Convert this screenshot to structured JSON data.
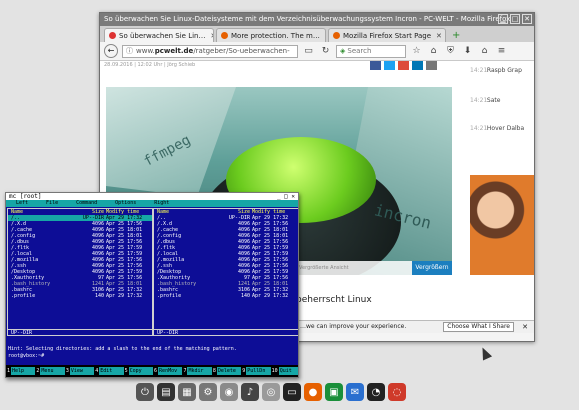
{
  "firefox": {
    "title": "So überwachen Sie Linux-Dateisysteme mit dem Verzeichnisüberwachungssystem Incron - PC-WELT - Mozilla Firefox",
    "window_controls": [
      "▁",
      "□",
      "✕"
    ],
    "tabs": [
      {
        "label": "So überwachen Sie Lin…",
        "active": true
      },
      {
        "label": "More protection. The m…",
        "active": false
      },
      {
        "label": "Mozilla Firefox Start Page",
        "active": false
      }
    ],
    "new_tab": "+",
    "url": {
      "prefix": "www.",
      "domain": "pcwelt.de",
      "path": "/ratgeber/So-ueberwachen-"
    },
    "search_placeholder": "Search",
    "toolbar_icons": [
      "☆",
      "⌂",
      "⛨",
      "⬇",
      "⌂",
      "≡"
    ]
  },
  "article": {
    "date_line": "28.09.2016 | 12:02 Uhr | Jörg Schieb",
    "image_engraving_1": "ffmpeg",
    "image_engraving_2": "incron",
    "image_caption": "Vergrößerte Ansicht",
    "enlarge_label": "Vergrößern",
    "headline": "beherrscht Linux"
  },
  "sidebar": {
    "news": [
      {
        "time": "14:21",
        "headline": "Raspb Grap"
      },
      {
        "time": "14:21",
        "headline": "Sate"
      },
      {
        "time": "14:21",
        "headline": "Hover Dalba"
      }
    ]
  },
  "notification": {
    "text": "…we can improve your experience.",
    "button": "Choose What I Share",
    "close": "✕"
  },
  "mc": {
    "title": "mc [root]",
    "title_controls": "_ □ ✕",
    "menu": [
      "Left",
      "File",
      "Command",
      "Options",
      "Right"
    ],
    "left_pane": {
      "headers": {
        "name": "Name",
        "size": "Size",
        "time": "Modify time"
      },
      "rows": [
        {
          "name": "/..",
          "size": "UP--DIR",
          "time": "Apr 29 17:32",
          "sel": true
        },
        {
          "name": "/.X.d",
          "size": "4096",
          "time": "Apr 25 17:56"
        },
        {
          "name": "/.cache",
          "size": "4096",
          "time": "Apr 25 18:01"
        },
        {
          "name": "/.config",
          "size": "4096",
          "time": "Apr 25 18:01"
        },
        {
          "name": "/.dbus",
          "size": "4096",
          "time": "Apr 25 17:56"
        },
        {
          "name": "/.fltk",
          "size": "4096",
          "time": "Apr 25 17:59"
        },
        {
          "name": "/.local",
          "size": "4096",
          "time": "Apr 25 17:59"
        },
        {
          "name": "/.mozilla",
          "size": "4096",
          "time": "Apr 25 17:56"
        },
        {
          "name": "/.ssh",
          "size": "4096",
          "time": "Apr 25 17:56"
        },
        {
          "name": "/Desktop",
          "size": "4096",
          "time": "Apr 25 17:59"
        },
        {
          "name": " .Xauthority",
          "size": "97",
          "time": "Apr 25 17:56"
        },
        {
          "name": " .bash_history",
          "size": "1241",
          "time": "Apr 25 18:01",
          "dim": true
        },
        {
          "name": " .bashrc",
          "size": "3106",
          "time": "Apr 25 17:32"
        },
        {
          "name": " .profile",
          "size": "140",
          "time": "Apr 29 17:32"
        }
      ],
      "footer": "UP--DIR"
    },
    "right_pane": {
      "headers": {
        "name": "Name",
        "size": "Size",
        "time": "Modify time"
      },
      "rows": [
        {
          "name": "/..",
          "size": "UP--DIR",
          "time": "Apr 29 17:32"
        },
        {
          "name": "/.X.d",
          "size": "4096",
          "time": "Apr 25 17:56"
        },
        {
          "name": "/.cache",
          "size": "4096",
          "time": "Apr 25 18:01"
        },
        {
          "name": "/.config",
          "size": "4096",
          "time": "Apr 25 18:01"
        },
        {
          "name": "/.dbus",
          "size": "4096",
          "time": "Apr 25 17:56"
        },
        {
          "name": "/.fltk",
          "size": "4096",
          "time": "Apr 25 17:59"
        },
        {
          "name": "/.local",
          "size": "4096",
          "time": "Apr 25 17:59"
        },
        {
          "name": "/.mozilla",
          "size": "4096",
          "time": "Apr 25 17:56"
        },
        {
          "name": "/.ssh",
          "size": "4096",
          "time": "Apr 25 17:56"
        },
        {
          "name": "/Desktop",
          "size": "4096",
          "time": "Apr 25 17:59"
        },
        {
          "name": " .Xauthority",
          "size": "97",
          "time": "Apr 25 17:56"
        },
        {
          "name": " .bash_history",
          "size": "1241",
          "time": "Apr 25 18:01",
          "dim": true
        },
        {
          "name": " .bashrc",
          "size": "3106",
          "time": "Apr 25 17:32"
        },
        {
          "name": " .profile",
          "size": "140",
          "time": "Apr 29 17:32"
        }
      ],
      "footer": "UP--DIR"
    },
    "hint": "Hint: Selecting directories: add a slash to the end of the matching pattern.",
    "prompt": "root@vbox:~#",
    "fkeys": [
      {
        "n": "1",
        "l": "Help"
      },
      {
        "n": "2",
        "l": "Menu"
      },
      {
        "n": "3",
        "l": "View"
      },
      {
        "n": "4",
        "l": "Edit"
      },
      {
        "n": "5",
        "l": "Copy"
      },
      {
        "n": "6",
        "l": "RenMov"
      },
      {
        "n": "7",
        "l": "Mkdir"
      },
      {
        "n": "8",
        "l": "Delete"
      },
      {
        "n": "9",
        "l": "PullDn"
      },
      {
        "n": "10",
        "l": "Quit"
      }
    ]
  },
  "dock": {
    "items": [
      {
        "icon": "power-icon",
        "glyph": "⏻",
        "color": "#555555"
      },
      {
        "icon": "terminal-icon",
        "glyph": "▤",
        "color": "#333333"
      },
      {
        "icon": "files-icon",
        "glyph": "▦",
        "color": "#666666"
      },
      {
        "icon": "settings-icon",
        "glyph": "⚙",
        "color": "#777777"
      },
      {
        "icon": "web-icon",
        "glyph": "◉",
        "color": "#8a8a8a"
      },
      {
        "icon": "music-icon",
        "glyph": "♪",
        "color": "#444444"
      },
      {
        "icon": "speaker-icon",
        "glyph": "◎",
        "color": "#9a9a9a"
      },
      {
        "icon": "console-icon",
        "glyph": "▭",
        "color": "#222222"
      },
      {
        "icon": "firefox-icon",
        "glyph": "●",
        "color": "#e66000"
      },
      {
        "icon": "office-icon",
        "glyph": "▣",
        "color": "#1a8f3a"
      },
      {
        "icon": "mail-icon",
        "glyph": "✉",
        "color": "#2a6fcf"
      },
      {
        "icon": "chat-icon",
        "glyph": "◔",
        "color": "#222222"
      },
      {
        "icon": "network-icon",
        "glyph": "◌",
        "color": "#cf3a2a"
      }
    ]
  }
}
